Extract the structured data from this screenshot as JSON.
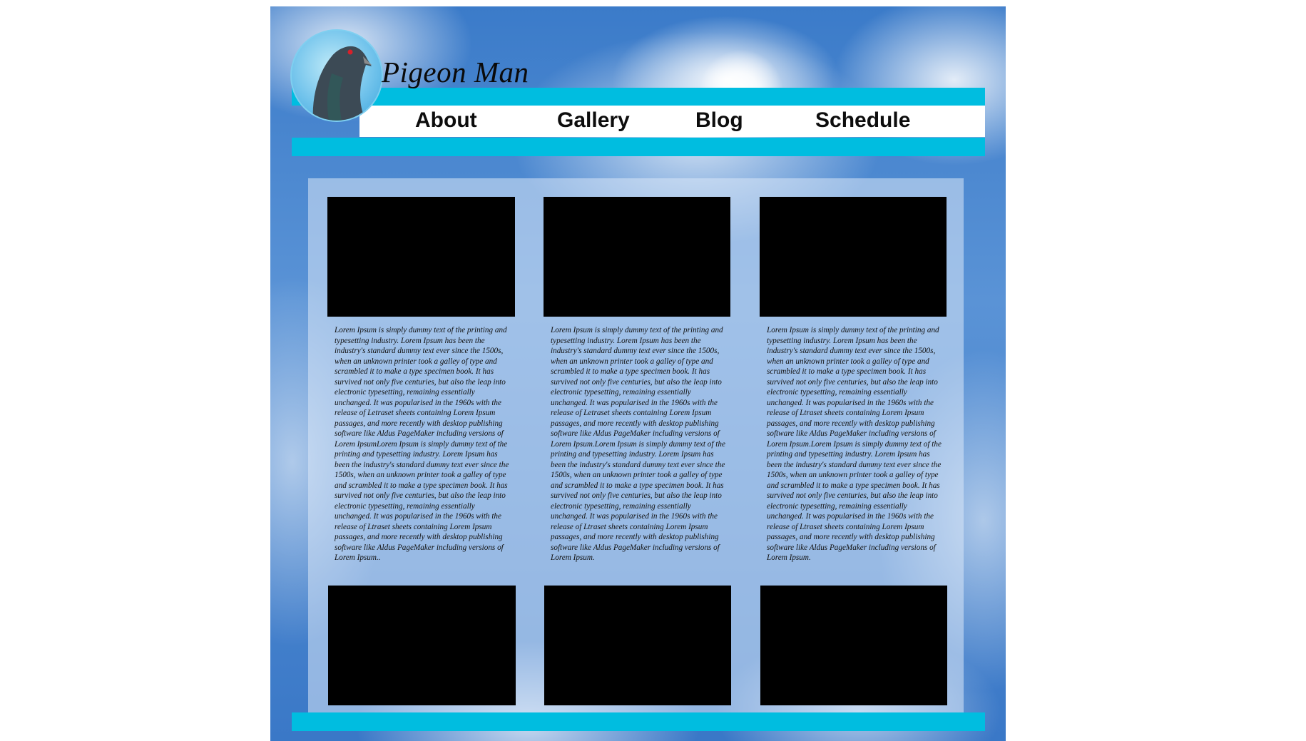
{
  "header": {
    "brand": "Pigeon Man",
    "nav": [
      "About",
      "Gallery",
      "Blog",
      "Schedule"
    ]
  },
  "colors": {
    "accent_bar": "#00bde0",
    "sky": "#3b7bc9",
    "panel": "#dae8f8",
    "thumbnail": "#000000"
  },
  "icons": {
    "logo": "pigeon-logo-icon"
  },
  "posts": [
    {
      "text": "Lorem Ipsum is simply dummy text of the printing and typesetting industry. Lorem Ipsum has been the industry's standard dummy text ever since the 1500s, when an unknown printer took a galley of type and scrambled it to make a type specimen book. It has survived not only five centuries, but also the leap into electronic typesetting, remaining essentially unchanged. It was popularised in the 1960s with the release of Letraset sheets containing Lorem Ipsum passages, and more recently with desktop publishing software like Aldus PageMaker including versions of Lorem IpsumLorem Ipsum is simply dummy text of the printing and typesetting industry. Lorem Ipsum has been the industry's standard dummy text ever since the 1500s, when an unknown printer took a galley of type and scrambled it to make a type specimen book. It has survived not only five centuries, but also the leap into electronic typesetting, remaining essentially unchanged. It was popularised in the 1960s with the release of Ltraset sheets containing Lorem Ipsum passages, and more recently with desktop publishing software like Aldus PageMaker including versions of Lorem Ipsum.."
    },
    {
      "text": "Lorem Ipsum is simply dummy text of the printing and typesetting industry. Lorem Ipsum has been the industry's standard dummy text ever since the 1500s, when an unknown printer took a galley of type and scrambled it to make a type specimen book. It has survived not only five centuries, but also the leap into electronic typesetting, remaining essentially unchanged. It was popularised in the 1960s with the release of Letraset sheets containing Lorem Ipsum passages, and more recently with desktop publishing software like Aldus PageMaker including versions of Lorem Ipsum.Lorem Ipsum is simply dummy text of the printing and typesetting industry. Lorem Ipsum has been the industry's standard dummy text ever since the 1500s, when an unknown printer took a galley of type and scrambled it to make a type specimen book. It has survived not only five centuries, but also the leap into electronic typesetting, remaining essentially unchanged. It was popularised in the 1960s with the release of Ltraset sheets containing Lorem Ipsum passages, and more recently with desktop publishing software like Aldus PageMaker including versions of Lorem Ipsum."
    },
    {
      "text": "Lorem Ipsum is simply dummy text of the printing and typesetting industry. Lorem Ipsum has been the industry's standard dummy text ever since the 1500s, when an unknown printer took a galley of type and scrambled it to make a type specimen book. It has survived not only five centuries, but also the leap into electronic typesetting, remaining essentially unchanged. It was popularised in the 1960s with the release of Ltraset sheets containing Lorem Ipsum passages, and more recently with desktop publishing software like Aldus PageMaker including versions of Lorem Ipsum.Lorem Ipsum is simply dummy text of the printing and typesetting industry. Lorem Ipsum has been the industry's standard dummy text ever since the 1500s, when an unknown printer took a galley of type and scrambled it to make a type specimen book. It has survived not only five centuries, but also the leap into electronic typesetting, remaining essentially unchanged. It was popularised in the 1960s with the release of Ltraset sheets containing Lorem Ipsum passages, and more recently with desktop publishing software like Aldus PageMaker including versions of Lorem Ipsum."
    }
  ]
}
